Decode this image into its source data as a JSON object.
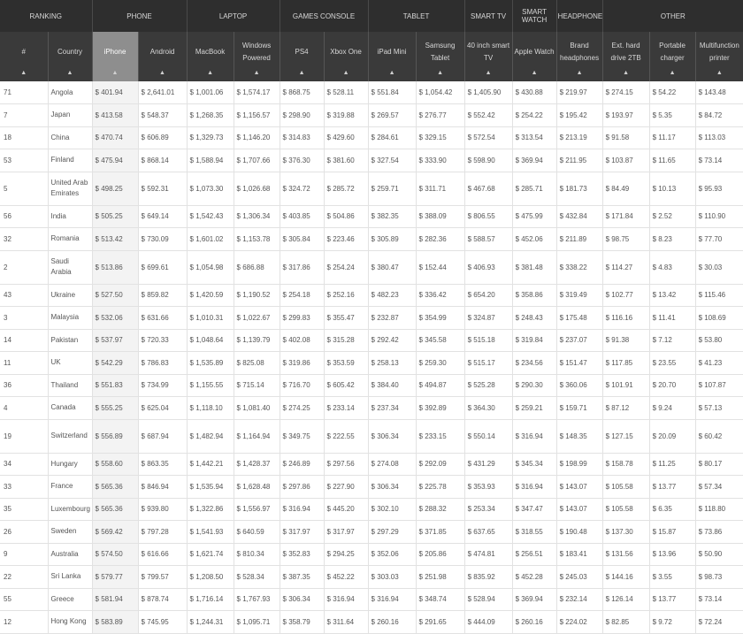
{
  "groups": [
    "RANKING",
    "PHONE",
    "LAPTOP",
    "GAMES CONSOLE",
    "TABLET",
    "SMART TV",
    "SMART WATCH",
    "HEADPHONES",
    "OTHER"
  ],
  "columns": [
    "#",
    "Country",
    "iPhone",
    "Android",
    "MacBook",
    "Windows Powered",
    "PS4",
    "Xbox One",
    "iPad Mini",
    "Samsung Tablet",
    "40 inch smart TV",
    "Apple Watch",
    "Brand headphones",
    "Ext. hard drive 2TB",
    "Portable charger",
    "Multifunction printer"
  ],
  "sort_icon": "triangle-up",
  "rows": [
    [
      "71",
      "Angola",
      "$ 401.94",
      "$ 2,641.01",
      "$ 1,001.06",
      "$ 1,574.17",
      "$ 868.75",
      "$ 528.11",
      "$ 551.84",
      "$ 1,054.42",
      "$ 1,405.90",
      "$ 430.88",
      "$ 219.97",
      "$ 274.15",
      "$ 54.22",
      "$ 143.48"
    ],
    [
      "7",
      "Japan",
      "$ 413.58",
      "$ 548.37",
      "$ 1,268.35",
      "$ 1,156.57",
      "$ 298.90",
      "$ 319.88",
      "$ 269.57",
      "$ 276.77",
      "$ 552.42",
      "$ 254.22",
      "$ 195.42",
      "$ 193.97",
      "$ 5.35",
      "$ 84.72"
    ],
    [
      "18",
      "China",
      "$ 470.74",
      "$ 606.89",
      "$ 1,329.73",
      "$ 1,146.20",
      "$ 314.83",
      "$ 429.60",
      "$ 284.61",
      "$ 329.15",
      "$ 572.54",
      "$ 313.54",
      "$ 213.19",
      "$ 91.58",
      "$ 11.17",
      "$ 113.03"
    ],
    [
      "53",
      "Finland",
      "$ 475.94",
      "$ 868.14",
      "$ 1,588.94",
      "$ 1,707.66",
      "$ 376.30",
      "$ 381.60",
      "$ 327.54",
      "$ 333.90",
      "$ 598.90",
      "$ 369.94",
      "$ 211.95",
      "$ 103.87",
      "$ 11.65",
      "$ 73.14"
    ],
    [
      "5",
      "United Arab Emirates",
      "$ 498.25",
      "$ 592.31",
      "$ 1,073.30",
      "$ 1,026.68",
      "$ 324.72",
      "$ 285.72",
      "$ 259.71",
      "$ 311.71",
      "$ 467.68",
      "$ 285.71",
      "$ 181.73",
      "$ 84.49",
      "$ 10.13",
      "$ 95.93"
    ],
    [
      "56",
      "India",
      "$ 505.25",
      "$ 649.14",
      "$ 1,542.43",
      "$ 1,306.34",
      "$ 403.85",
      "$ 504.86",
      "$ 382.35",
      "$ 388.09",
      "$ 806.55",
      "$ 475.99",
      "$ 432.84",
      "$ 171.84",
      "$ 2.52",
      "$ 110.90"
    ],
    [
      "32",
      "Romania",
      "$ 513.42",
      "$ 730.09",
      "$ 1,601.02",
      "$ 1,153.78",
      "$ 305.84",
      "$ 223.46",
      "$ 305.89",
      "$ 282.36",
      "$ 588.57",
      "$ 452.06",
      "$ 211.89",
      "$ 98.75",
      "$ 8.23",
      "$ 77.70"
    ],
    [
      "2",
      "Saudi Arabia",
      "$ 513.86",
      "$ 699.61",
      "$ 1,054.98",
      "$ 686.88",
      "$ 317.86",
      "$ 254.24",
      "$ 380.47",
      "$ 152.44",
      "$ 406.93",
      "$ 381.48",
      "$ 338.22",
      "$ 114.27",
      "$ 4.83",
      "$ 30.03"
    ],
    [
      "43",
      "Ukraine",
      "$ 527.50",
      "$ 859.82",
      "$ 1,420.59",
      "$ 1,190.52",
      "$ 254.18",
      "$ 252.16",
      "$ 482.23",
      "$ 336.42",
      "$ 654.20",
      "$ 358.86",
      "$ 319.49",
      "$ 102.77",
      "$ 13.42",
      "$ 115.46"
    ],
    [
      "3",
      "Malaysia",
      "$ 532.06",
      "$ 631.66",
      "$ 1,010.31",
      "$ 1,022.67",
      "$ 299.83",
      "$ 355.47",
      "$ 232.87",
      "$ 354.99",
      "$ 324.87",
      "$ 248.43",
      "$ 175.48",
      "$ 116.16",
      "$ 11.41",
      "$ 108.69"
    ],
    [
      "14",
      "Pakistan",
      "$ 537.97",
      "$ 720.33",
      "$ 1,048.64",
      "$ 1,139.79",
      "$ 402.08",
      "$ 315.28",
      "$ 292.42",
      "$ 345.58",
      "$ 515.18",
      "$ 319.84",
      "$ 237.07",
      "$ 91.38",
      "$ 7.12",
      "$ 53.80"
    ],
    [
      "11",
      "UK",
      "$ 542.29",
      "$ 786.83",
      "$ 1,535.89",
      "$ 825.08",
      "$ 319.86",
      "$ 353.59",
      "$ 258.13",
      "$ 259.30",
      "$ 515.17",
      "$ 234.56",
      "$ 151.47",
      "$ 117.85",
      "$ 23.55",
      "$ 41.23"
    ],
    [
      "36",
      "Thailand",
      "$ 551.83",
      "$ 734.99",
      "$ 1,155.55",
      "$ 715.14",
      "$ 716.70",
      "$ 605.42",
      "$ 384.40",
      "$ 494.87",
      "$ 525.28",
      "$ 290.30",
      "$ 360.06",
      "$ 101.91",
      "$ 20.70",
      "$ 107.87"
    ],
    [
      "4",
      "Canada",
      "$ 555.25",
      "$ 625.04",
      "$ 1,118.10",
      "$ 1,081.40",
      "$ 274.25",
      "$ 233.14",
      "$ 237.34",
      "$ 392.89",
      "$ 364.30",
      "$ 259.21",
      "$ 159.71",
      "$ 87.12",
      "$ 9.24",
      "$ 57.13"
    ],
    [
      "19",
      "Switzerland",
      "$ 556.89",
      "$ 687.94",
      "$ 1,482.94",
      "$ 1,164.94",
      "$ 349.75",
      "$ 222.55",
      "$ 306.34",
      "$ 233.15",
      "$ 550.14",
      "$ 316.94",
      "$ 148.35",
      "$ 127.15",
      "$ 20.09",
      "$ 60.42"
    ],
    [
      "34",
      "Hungary",
      "$ 558.60",
      "$ 863.35",
      "$ 1,442.21",
      "$ 1,428.37",
      "$ 246.89",
      "$ 297.56",
      "$ 274.08",
      "$ 292.09",
      "$ 431.29",
      "$ 345.34",
      "$ 198.99",
      "$ 158.78",
      "$ 11.25",
      "$ 80.17"
    ],
    [
      "33",
      "France",
      "$ 565.36",
      "$ 846.94",
      "$ 1,535.94",
      "$ 1,628.48",
      "$ 297.86",
      "$ 227.90",
      "$ 306.34",
      "$ 225.78",
      "$ 353.93",
      "$ 316.94",
      "$ 143.07",
      "$ 105.58",
      "$ 13.77",
      "$ 57.34"
    ],
    [
      "35",
      "Luxembourg",
      "$ 565.36",
      "$ 939.80",
      "$ 1,322.86",
      "$ 1,556.97",
      "$ 316.94",
      "$ 445.20",
      "$ 302.10",
      "$ 288.32",
      "$ 253.34",
      "$ 347.47",
      "$ 143.07",
      "$ 105.58",
      "$ 6.35",
      "$ 118.80"
    ],
    [
      "26",
      "Sweden",
      "$ 569.42",
      "$ 797.28",
      "$ 1,541.93",
      "$ 640.59",
      "$ 317.97",
      "$ 317.97",
      "$ 297.29",
      "$ 371.85",
      "$ 637.65",
      "$ 318.55",
      "$ 190.48",
      "$ 137.30",
      "$ 15.87",
      "$ 73.86"
    ],
    [
      "9",
      "Australia",
      "$ 574.50",
      "$ 616.66",
      "$ 1,621.74",
      "$ 810.34",
      "$ 352.83",
      "$ 294.25",
      "$ 352.06",
      "$ 205.86",
      "$ 474.81",
      "$ 256.51",
      "$ 183.41",
      "$ 131.56",
      "$ 13.96",
      "$ 50.90"
    ],
    [
      "22",
      "Sri Lanka",
      "$ 579.77",
      "$ 799.57",
      "$ 1,208.50",
      "$ 528.34",
      "$ 387.35",
      "$ 452.22",
      "$ 303.03",
      "$ 251.98",
      "$ 835.92",
      "$ 452.28",
      "$ 245.03",
      "$ 144.16",
      "$ 3.55",
      "$ 98.73"
    ],
    [
      "55",
      "Greece",
      "$ 581.94",
      "$ 878.74",
      "$ 1,716.14",
      "$ 1,767.93",
      "$ 306.34",
      "$ 316.94",
      "$ 316.94",
      "$ 348.74",
      "$ 528.94",
      "$ 369.94",
      "$ 232.14",
      "$ 126.14",
      "$ 13.77",
      "$ 73.14"
    ],
    [
      "12",
      "Hong Kong",
      "$ 583.89",
      "$ 745.95",
      "$ 1,244.31",
      "$ 1,095.71",
      "$ 358.79",
      "$ 311.64",
      "$ 260.16",
      "$ 291.65",
      "$ 444.09",
      "$ 260.16",
      "$ 224.02",
      "$ 82.85",
      "$ 9.72",
      "$ 72.24"
    ]
  ]
}
